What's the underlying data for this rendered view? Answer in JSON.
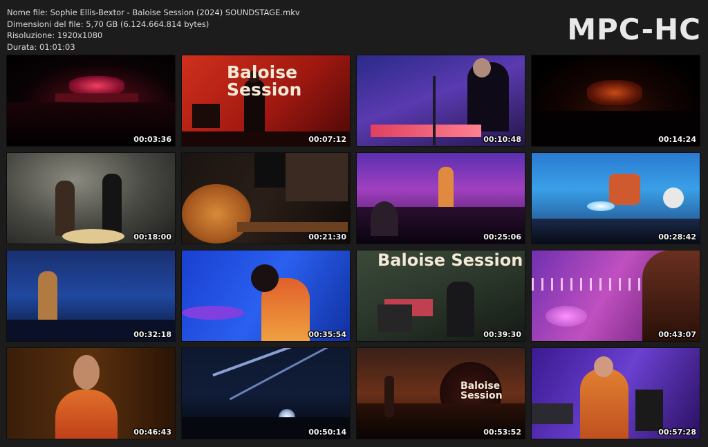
{
  "file_info": {
    "name": "Nome file: Sophie Ellis-Bextor - Baloise Session (2024) SOUNDSTAGE.mkv",
    "size": "Dimensioni del file: 5,70 GB (6.124.664.814 bytes)",
    "resolution": "Risoluzione: 1920x1080",
    "duration": "Durata: 01:01:03"
  },
  "logo": "MPC-HC",
  "channel_logo_icon": "arte-channel-logo",
  "thumbnails": [
    {
      "time": "00:03:36",
      "scene": "wide-stage-red"
    },
    {
      "time": "00:07:12",
      "scene": "guitarist-red-baloise",
      "banner": "Baloise Session"
    },
    {
      "time": "00:10:48",
      "scene": "keyboard-purple"
    },
    {
      "time": "00:14:24",
      "scene": "wide-stage-dark"
    },
    {
      "time": "00:18:00",
      "scene": "singer-smoke"
    },
    {
      "time": "00:21:30",
      "scene": "acoustic-guitar-closeup"
    },
    {
      "time": "00:25:06",
      "scene": "crowd-purple"
    },
    {
      "time": "00:28:42",
      "scene": "singer-blue-band"
    },
    {
      "time": "00:32:18",
      "scene": "singer-blue-crowd"
    },
    {
      "time": "00:35:54",
      "scene": "singer-blue-closeup"
    },
    {
      "time": "00:39:30",
      "scene": "band-green-baloise",
      "banner": "Baloise Session"
    },
    {
      "time": "00:43:07",
      "scene": "pink-truss-closeup"
    },
    {
      "time": "00:46:43",
      "scene": "singer-orange-closeup"
    },
    {
      "time": "00:50:14",
      "scene": "lightbeams-dark"
    },
    {
      "time": "00:53:52",
      "scene": "crowd-hands-red",
      "banner": "Baloise Session"
    },
    {
      "time": "00:57:28",
      "scene": "singer-purple-wave"
    }
  ]
}
